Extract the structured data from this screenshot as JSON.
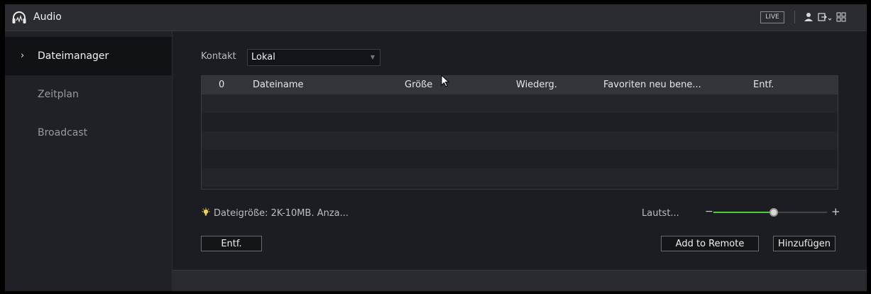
{
  "titlebar": {
    "app_title": "Audio",
    "live_label": "LIVE",
    "icons": [
      "headphones-logo-icon",
      "user-icon",
      "logout-icon",
      "grid-menu-icon"
    ]
  },
  "sidebar": {
    "items": [
      {
        "label": "Dateimanager",
        "active": true
      },
      {
        "label": "Zeitplan",
        "active": false
      },
      {
        "label": "Broadcast",
        "active": false
      }
    ]
  },
  "main": {
    "kontakt_label": "Kontakt",
    "kontakt_value": "Lokal",
    "table": {
      "columns": [
        "0",
        "Dateiname",
        "Größe",
        "Wiederg.",
        "Favoriten neu bene...",
        "Entf."
      ],
      "rows": []
    },
    "info_text": "Dateigröße: 2K-10MB. Anza...",
    "volume_label": "Lautst...",
    "volume_minus": "−",
    "volume_plus": "+",
    "volume_level_percent": 53,
    "delete_button": "Entf.",
    "add_to_remote_button": "Add to Remote",
    "add_button": "Hinzufügen"
  },
  "colors": {
    "accent_green": "#4ccf3a",
    "background": "#1c1d22"
  }
}
